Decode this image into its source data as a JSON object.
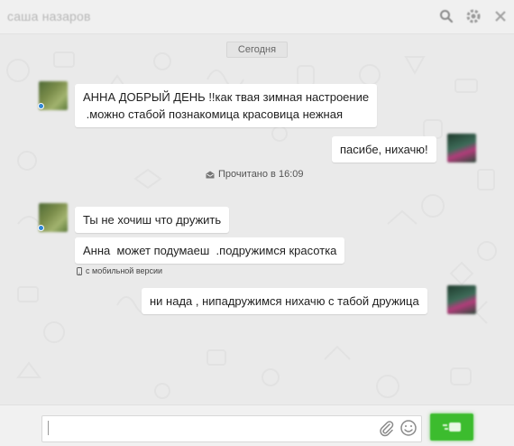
{
  "header": {
    "contact_name": "саша назаров"
  },
  "chat": {
    "day_separator": "Сегодня",
    "read_status": "Прочитано в 16:09",
    "mobile_label": "с мобильной версии",
    "messages": [
      {
        "direction": "incoming",
        "text": "АННА ДОБРЫЙ ДЕНЬ !!как твая зимная настроение\n .можно стабой познакомица красовица нежная"
      },
      {
        "direction": "outgoing",
        "text": "пасибе, нихачю!"
      },
      {
        "direction": "incoming",
        "text": "Ты не хочиш что дружить"
      },
      {
        "direction": "incoming",
        "text": "Анна  может подумаеш  .подружимся красотка"
      },
      {
        "direction": "outgoing",
        "text": "ни нада , нипадружимся нихачю с табой дружица"
      }
    ]
  },
  "composer": {
    "input_value": ""
  },
  "colors": {
    "send_button": "#3cbc2e",
    "online_dot": "#2f86d6",
    "chat_background": "#eaeaea"
  },
  "icons": {
    "header": [
      "search-icon",
      "settings-icon",
      "close-icon"
    ],
    "composer": [
      "paperclip-icon",
      "smiley-icon",
      "send-icon"
    ],
    "meta": [
      "envelope-icon",
      "phone-icon"
    ]
  }
}
